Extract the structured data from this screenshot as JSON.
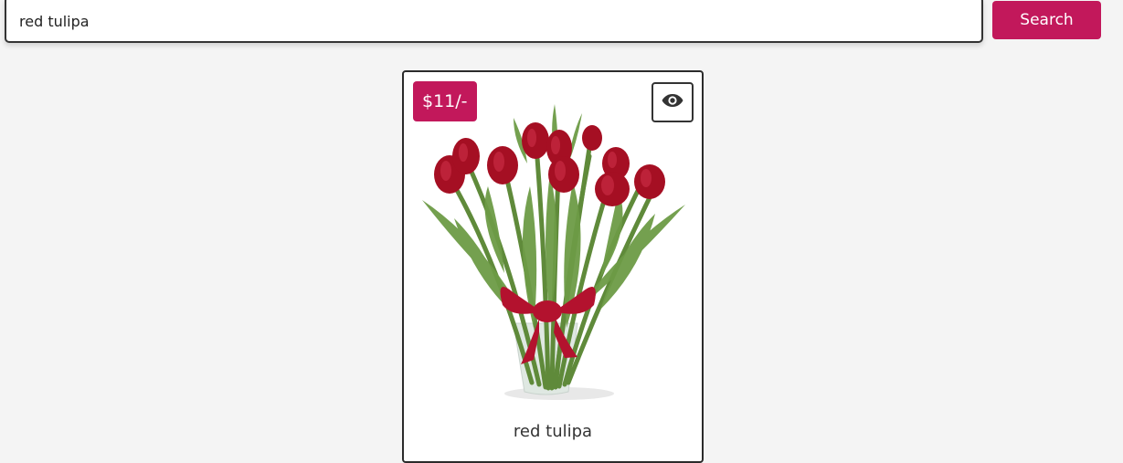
{
  "search": {
    "value": "red tulipa",
    "button_label": "Search"
  },
  "product": {
    "price": "$11/-",
    "name": "red tulipa",
    "view_icon": "eye-icon",
    "image": "red-tulip-bouquet-in-vase"
  },
  "colors": {
    "accent": "#c2185b",
    "background": "#f4f4f4",
    "border": "#333333"
  }
}
